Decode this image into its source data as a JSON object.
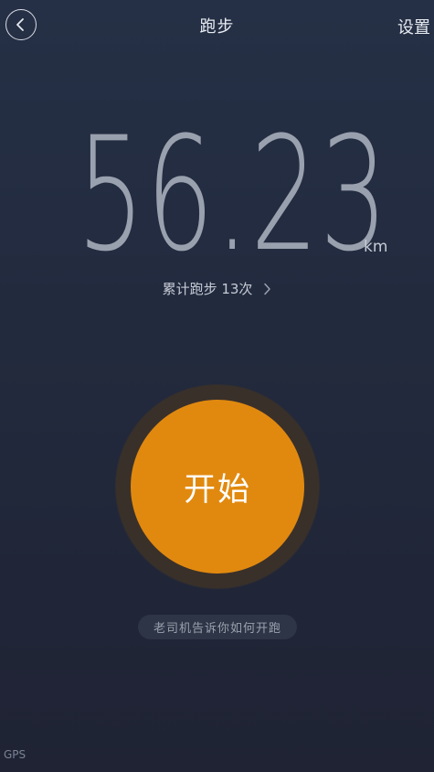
{
  "header": {
    "back_icon": "chevron-left-icon",
    "title": "跑步",
    "settings_label": "设置"
  },
  "distance": {
    "value": "56.23",
    "unit": "km"
  },
  "total_runs": {
    "label": "累计跑步 13次",
    "chevron_icon": "chevron-right-icon"
  },
  "start": {
    "label": "开始",
    "color": "#e1890f"
  },
  "tutorial": {
    "label": "老司机告诉你如何开跑"
  },
  "status": {
    "gps_label": "GPS"
  }
}
